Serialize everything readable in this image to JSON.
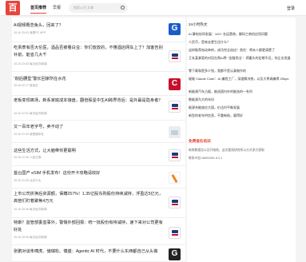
{
  "header": {
    "logo_text": "百",
    "nav": [
      "首页推荐",
      "早报"
    ],
    "search_placeholder": "搜索公司  文章",
    "login": "登录"
  },
  "feed": [
    {
      "title": "AI视频概念兔头，回来了？",
      "meta": "15.16 25:03 我是PC APP",
      "thumb": "blue"
    },
    {
      "title": "吃贵表有否大伦医，酒品否被看白虫：你们放放的，不懂酒店网车上了？加客告别补前，能省几大千",
      "meta": "15.16 23:02 每日经济新闻",
      "thumb": "logo-white"
    },
    {
      "title": "“削后腰型”警长回家所在水花",
      "meta": "15.16 02:17 新经社",
      "thumb": "red"
    },
    {
      "title": "老板变现离场，新系家底成本接盘，翻倍股星中生AI跨界背后：是外赢是隐身者？",
      "meta": "15.16 22:02 每日经济新闻",
      "thumb": "logo-white"
    },
    {
      "title": "又一百年老字号，卖不动了",
      "meta": "15.16 21:34 我是媒体社",
      "thumb": "gray"
    },
    {
      "title": "这些生活方式，让大脑带你更聪明",
      "meta": "15.16 21:30 人民日报",
      "thumb": "logo-white"
    },
    {
      "title": "首台国产 eSIM 手机发布！这份开卡攻略请收好",
      "meta": "15.16 21:05 北京力大",
      "thumb": "orange"
    },
    {
      "title": "上市公司折换后资源额，保樽257%！1.35亿股东购股份持续减持，浮盈达5亿元，高管们盯着聚焦4万元",
      "meta": "15.16 20:46 每日经济新闻",
      "thumb": "logo-white"
    },
    {
      "title": "特斯？监管部委监事外，警惕外部回报：统一批股份有待减持，速下来对公司更有好处",
      "meta": "15.16 20:46 每日经济新闻",
      "thumb": "logo-white"
    },
    {
      "title": "张鹏对谈朱啸虎、储瑞松、傅盛：Agentic AI 时代，不要什么东西都自己从头做",
      "meta": "",
      "thumb": "black"
    }
  ],
  "sidebar": {
    "title": "24小时热文",
    "hot": [
      "AI 算电协同发展：100+ 名运营商，解码工商机应用问题",
      "人民币，是来去更生还什么？",
      "这样推荐电动单剂，成功完全选应！责任：将未人都更清楚了",
      "王玄某拿案的对话在两AI界 “金融项出”：郑重头的定期不还，你企业发展",
      "零下载和是多少钱，我都不是认真制作的",
      "碰碰 Claude Code：AI 编程工厂，深度解决统，以及大将调编得 25bps",
      "新能源汽车占据，能选国内外的能选的一系列",
      "数能源为大的年份",
      "能源充能放应大国，价达约平衡发展",
      "新型的老年供信息，不重新结，要得好"
    ],
    "promo_title": "免费报名培训",
    "promo": [
      "新商数报告以及开始结，这次要找研究所以方式多方获取",
      "联系IP加:18651551 8 0.1"
    ]
  }
}
